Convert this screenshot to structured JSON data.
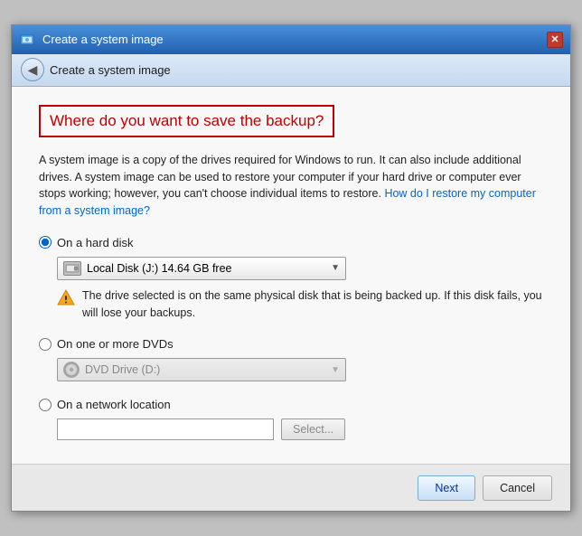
{
  "window": {
    "title": "Create a system image",
    "close_label": "✕"
  },
  "nav": {
    "back_arrow": "◀",
    "title": "Create a system image"
  },
  "heading": "Where do you want to save the backup?",
  "description": {
    "text1": "A system image is a copy of the drives required for Windows to run. It can also include additional drives. A system image can be used to restore your computer if your hard drive or computer ever stops working; however, you can't choose individual items to restore.",
    "link_text": "How do I restore my computer from a system image?"
  },
  "options": {
    "hard_disk": {
      "label": "On a hard disk",
      "checked": true,
      "dropdown_value": "Local Disk (J:)  14.64 GB free",
      "warning": "The drive selected is on the same physical disk that is being backed up. If this disk fails, you will lose your backups."
    },
    "dvd": {
      "label": "On one or more DVDs",
      "checked": false,
      "dropdown_value": "DVD Drive (D:)"
    },
    "network": {
      "label": "On a network location",
      "checked": false,
      "input_placeholder": "",
      "select_button_label": "Select..."
    }
  },
  "footer": {
    "next_label": "Next",
    "cancel_label": "Cancel"
  }
}
